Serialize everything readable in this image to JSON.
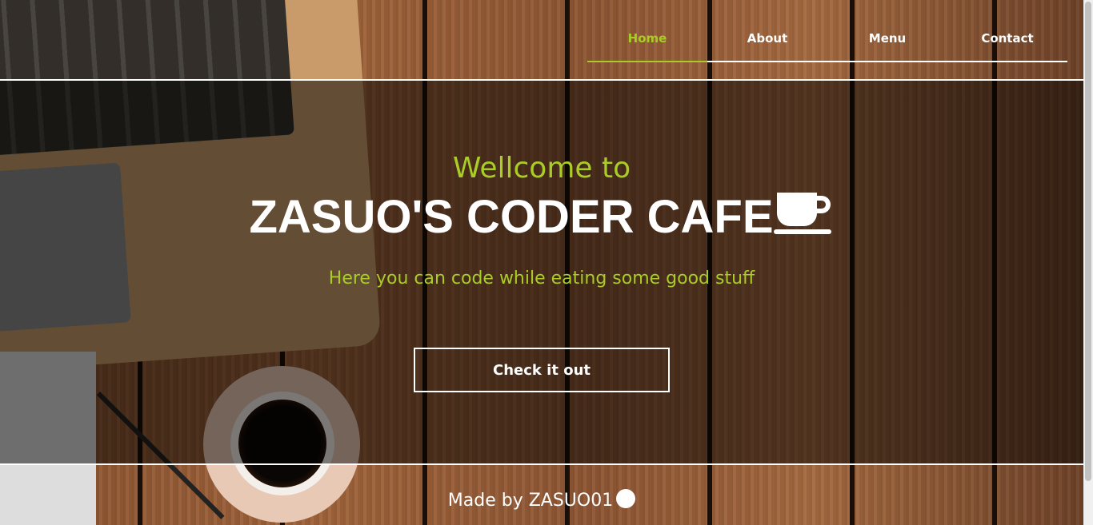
{
  "nav": {
    "items": [
      {
        "label": "Home",
        "active": true
      },
      {
        "label": "About"
      },
      {
        "label": "Menu"
      },
      {
        "label": "Contact"
      }
    ]
  },
  "hero": {
    "welcome": "Wellcome to",
    "title": "ZASUO'S CODER CAFE",
    "title_icon": "coffee-cup-icon",
    "subtitle": "Here you can code while eating some good stuff",
    "button": "Check it out"
  },
  "footer": {
    "text": "Made by ZASUO01",
    "icon": "github-icon"
  },
  "colors": {
    "accent": "#a9cc26",
    "text": "#ffffff"
  }
}
